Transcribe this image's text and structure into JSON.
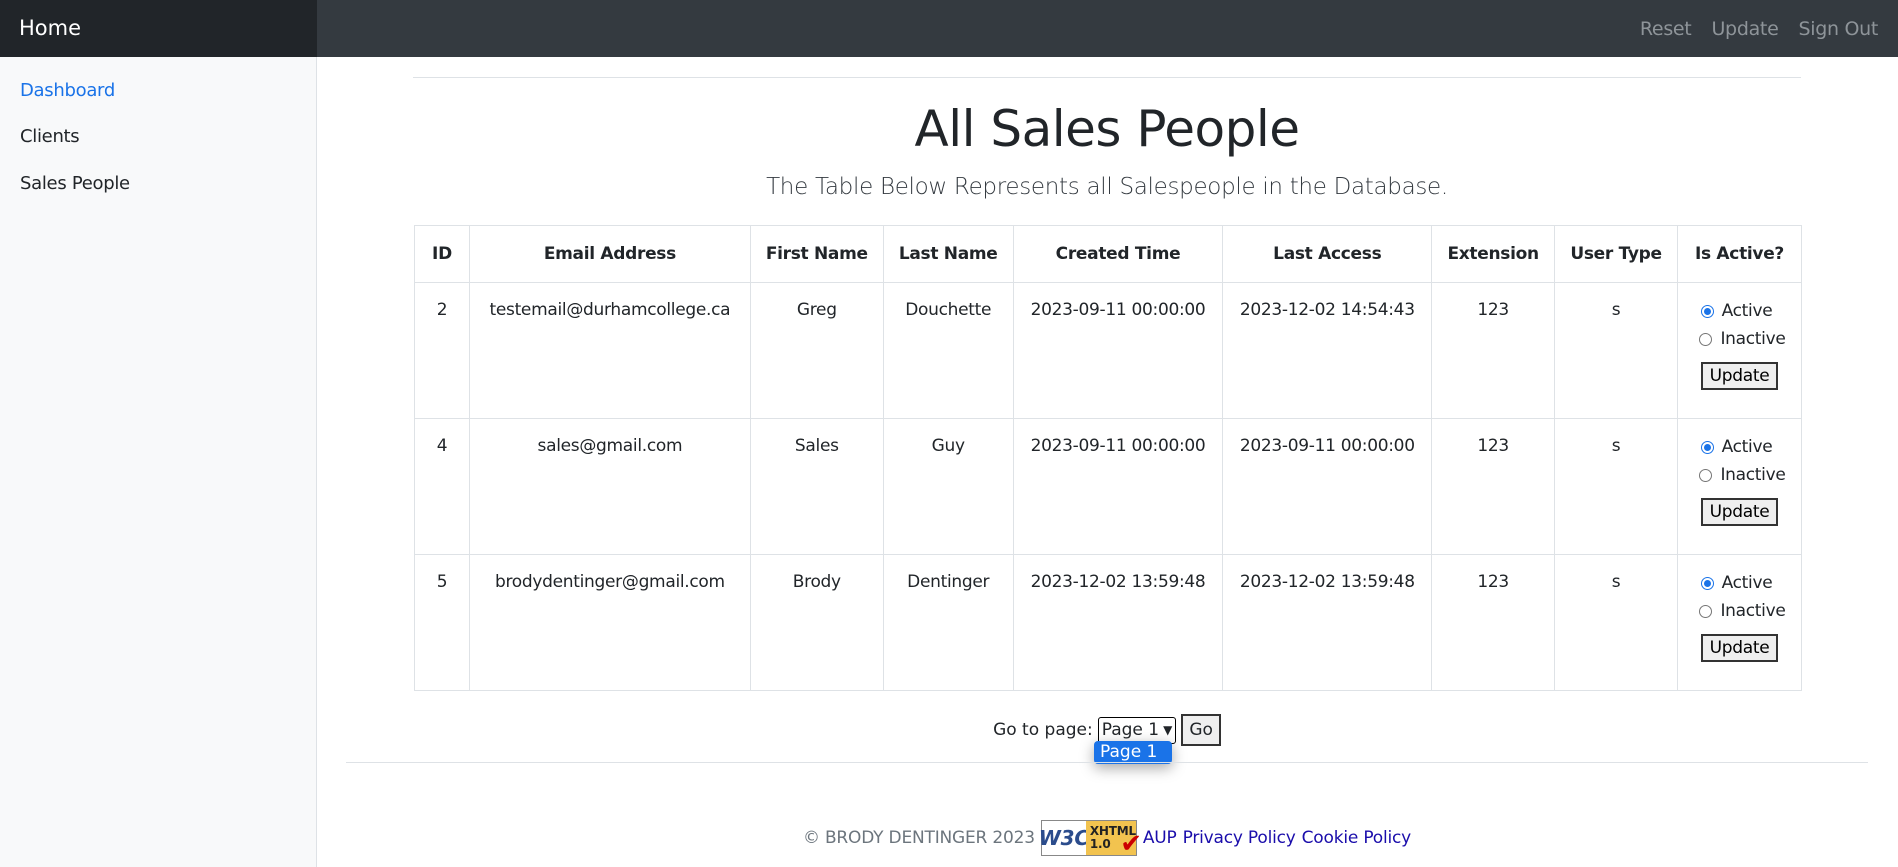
{
  "topbar": {
    "brand": "Home",
    "nav": [
      "Reset",
      "Update",
      "Sign Out"
    ]
  },
  "sidebar": {
    "items": [
      {
        "label": "Dashboard",
        "active": true
      },
      {
        "label": "Clients",
        "active": false
      },
      {
        "label": "Sales People",
        "active": false
      }
    ]
  },
  "main": {
    "title": "All Sales People",
    "subtitle": "The Table Below Represents all Salespeople in the Database.",
    "table": {
      "headers": [
        "ID",
        "Email Address",
        "First Name",
        "Last Name",
        "Created Time",
        "Last Access",
        "Extension",
        "User Type",
        "Is Active?"
      ],
      "rows": [
        {
          "id": "2",
          "email": "testemail@durhamcollege.ca",
          "first": "Greg",
          "last": "Douchette",
          "created": "2023-09-11 00:00:00",
          "access": "2023-12-02 14:54:43",
          "ext": "123",
          "type": "s",
          "status": "Active"
        },
        {
          "id": "4",
          "email": "sales@gmail.com",
          "first": "Sales",
          "last": "Guy",
          "created": "2023-09-11 00:00:00",
          "access": "2023-09-11 00:00:00",
          "ext": "123",
          "type": "s",
          "status": "Active"
        },
        {
          "id": "5",
          "email": "brodydentinger@gmail.com",
          "first": "Brody",
          "last": "Dentinger",
          "created": "2023-12-02 13:59:48",
          "access": "2023-12-02 13:59:48",
          "ext": "123",
          "type": "s",
          "status": "Active"
        }
      ],
      "radio_active_label": "Active",
      "radio_inactive_label": "Inactive",
      "update_label": "Update"
    },
    "pager": {
      "label": "Go to page:",
      "selected": "Page 1",
      "options": [
        "Page 1"
      ],
      "go_label": "Go"
    },
    "footer": {
      "copyright": "© BRODY DENTINGER 2023",
      "badge_left": "W3C",
      "badge_right_top": "XHTML",
      "badge_right_bottom": "1.0",
      "links": [
        "AUP",
        "Privacy Policy",
        "Cookie Policy"
      ]
    }
  },
  "colors": {
    "topbar": "#343a40",
    "brand_bg": "#212529",
    "accent": "#1a73e8",
    "sidebar_bg": "#f8f9fa"
  }
}
